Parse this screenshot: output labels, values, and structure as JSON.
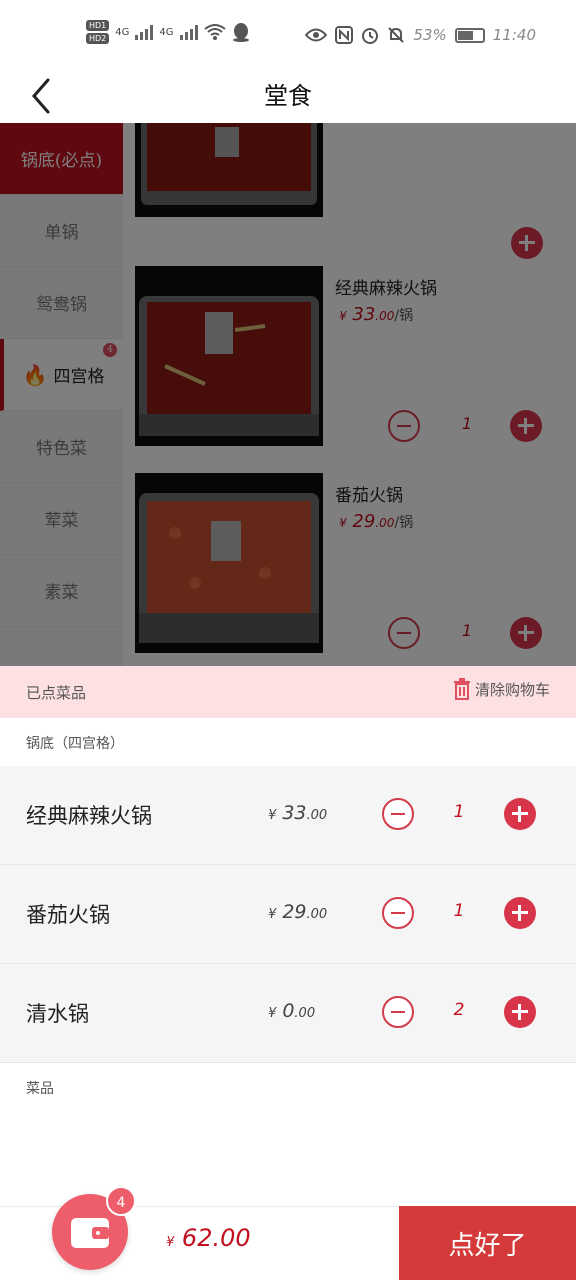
{
  "status_bar": {
    "hd1": "HD1",
    "hd2": "HD2",
    "net1": "4G",
    "net2": "4G",
    "battery": "53%",
    "time": "11:40"
  },
  "header": {
    "title": "堂食"
  },
  "sidebar": {
    "items": [
      {
        "label": "锅底(必点)"
      },
      {
        "label": "单锅"
      },
      {
        "label": "鸳鸯锅"
      },
      {
        "label": "四宫格",
        "badge": "4"
      },
      {
        "label": "特色菜"
      },
      {
        "label": "荤菜"
      },
      {
        "label": "素菜"
      }
    ]
  },
  "products": [
    {
      "name": "经典麻辣火锅",
      "currency": "¥",
      "price_int": "33",
      "price_dec": ".00",
      "unit": "/锅",
      "qty": "1"
    },
    {
      "name": "番茄火锅",
      "currency": "¥",
      "price_int": "29",
      "price_dec": ".00",
      "unit": "/锅",
      "qty": "1"
    }
  ],
  "cart": {
    "title": "已点菜品",
    "clear_label": "清除购物车",
    "section_pot": "锅底（四宫格）",
    "section_dishes": "菜品",
    "items": [
      {
        "name": "经典麻辣火锅",
        "currency": "¥",
        "price_int": "33",
        "price_dec": ".00",
        "qty": "1"
      },
      {
        "name": "番茄火锅",
        "currency": "¥",
        "price_int": "29",
        "price_dec": ".00",
        "qty": "1"
      },
      {
        "name": "清水锅",
        "currency": "¥",
        "price_int": "0",
        "price_dec": ".00",
        "qty": "2"
      }
    ]
  },
  "footer": {
    "cart_badge": "4",
    "currency": "¥",
    "total": "62.00",
    "submit_label": "点好了"
  },
  "colors": {
    "accent": "#d43a3a",
    "soft_pink": "#fde0e2"
  }
}
